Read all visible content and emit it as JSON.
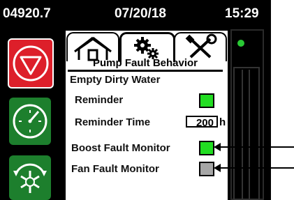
{
  "status_bar": {
    "hours": "04920.7",
    "date": "07/20/18",
    "time": "15:29"
  },
  "tabs": [
    {
      "name": "home",
      "icon": "home-icon"
    },
    {
      "name": "gears",
      "icon": "gears-icon"
    },
    {
      "name": "tools",
      "icon": "tools-icon"
    }
  ],
  "panel": {
    "title": "Pump Fault Behavior",
    "section": "Empty Dirty Water",
    "reminder_label": "Reminder",
    "reminder_time_label": "Reminder Time",
    "reminder_time_value": "200",
    "reminder_time_unit": "h",
    "boost_label": "Boost Fault Monitor",
    "fan_label": "Fan Fault Monitor"
  },
  "checkbox_states": {
    "reminder": "on",
    "boost": "on",
    "fan": "off"
  },
  "left_buttons": [
    {
      "name": "stop",
      "icon": "stop-icon"
    },
    {
      "name": "gauge",
      "icon": "gauge-icon"
    },
    {
      "name": "defrost",
      "icon": "defrost-icon"
    }
  ],
  "colors": {
    "on": "#22dd22",
    "off": "#a6a6a6",
    "stop_red": "#dd1f2a",
    "button_green": "#1d7f2d",
    "indicator_green": "#29c834"
  }
}
